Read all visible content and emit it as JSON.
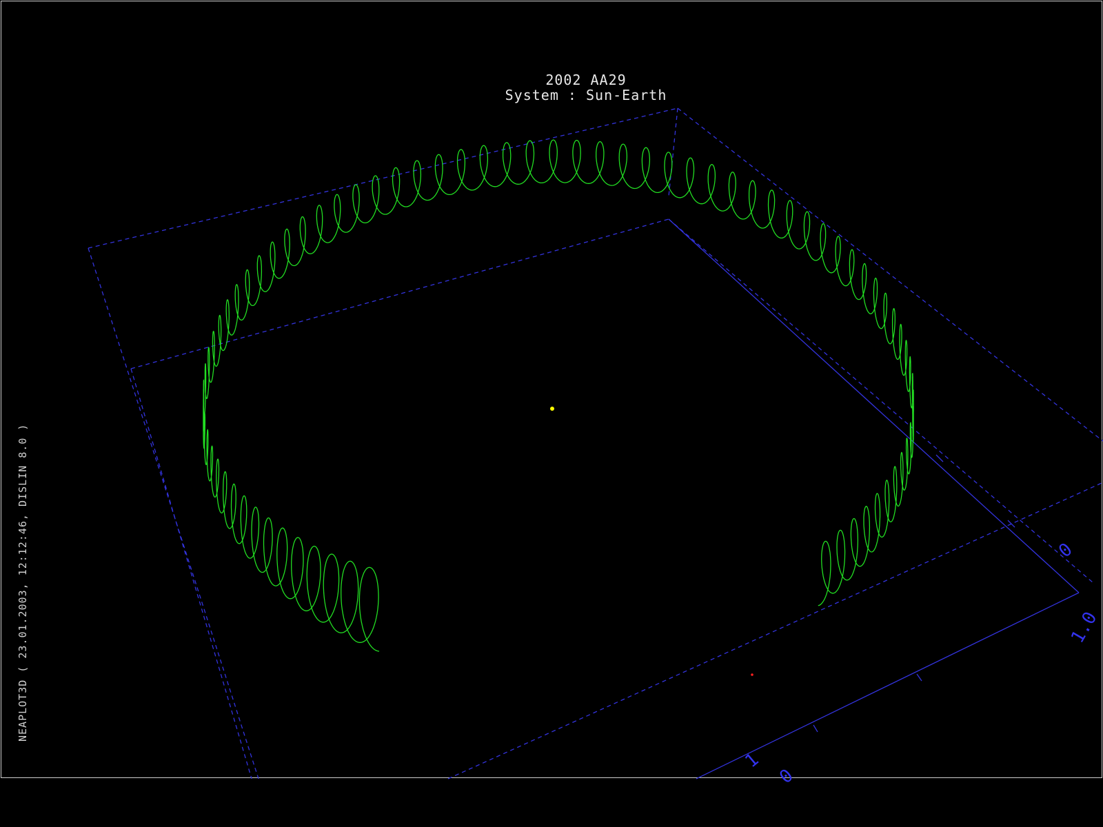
{
  "title": "2002 AA29",
  "subtitle": "System : Sun-Earth",
  "side_label": "NEAPLOT3D ( 23.01.2003, 12:12:46, DISLIN 8.0 )",
  "tick_labels": [
    "0",
    "1",
    "0",
    "1.0"
  ],
  "colors": {
    "background": "#000000",
    "orbit": "#22dd22",
    "box": "#3333dd",
    "sun": "#ffff00",
    "earth": "#ff2020",
    "text": "#e8e8e8"
  },
  "markers": {
    "sun": "sun",
    "earth": "earth"
  }
}
